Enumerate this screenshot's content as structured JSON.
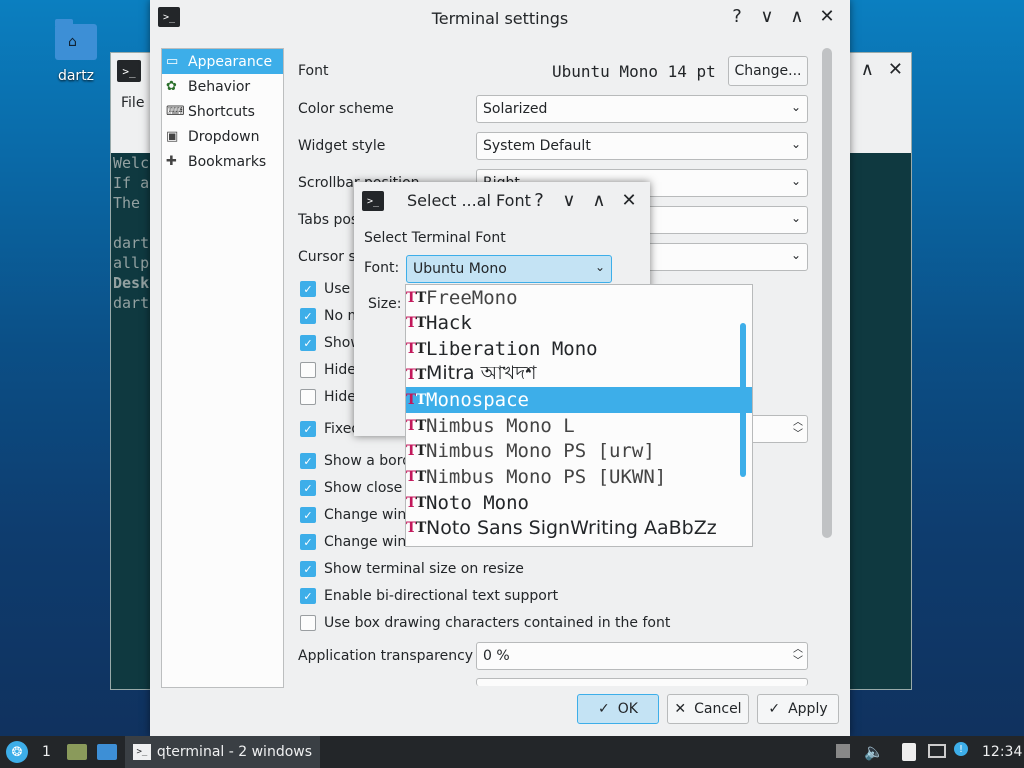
{
  "desktop": {
    "icon_label": "dartz"
  },
  "bg_window": {
    "menu_file": "File",
    "terminal_lines": [
      "Welc",
      "If a",
      "The ",
      "",
      "dart",
      "allp",
      "Desk",
      "dart"
    ]
  },
  "settings": {
    "title": "Terminal settings",
    "sidebar": [
      {
        "label": "Appearance",
        "icon": "monitor-icon"
      },
      {
        "label": "Behavior",
        "icon": "gear-icon"
      },
      {
        "label": "Shortcuts",
        "icon": "keyboard-icon"
      },
      {
        "label": "Dropdown",
        "icon": "dropdown-icon"
      },
      {
        "label": "Bookmarks",
        "icon": "bookmark-icon"
      }
    ],
    "font_label": "Font",
    "font_value": "Ubuntu Mono 14 pt",
    "change_button": "Change...",
    "color_scheme_label": "Color scheme",
    "color_scheme_value": "Solarized",
    "widget_style_label": "Widget style",
    "widget_style_value": "System Default",
    "scrollbar_label": "Scrollbar position",
    "scrollbar_value": "Right",
    "tabs_label": "Tabs pos",
    "cursor_label": "Cursor s",
    "partial_checks": [
      "Use l",
      "No m",
      "Show",
      "Hide",
      "Hide"
    ],
    "fixed_label": "Fixed",
    "checks": [
      {
        "label": "Show a bord",
        "on": true
      },
      {
        "label": "Show close b",
        "on": true
      },
      {
        "label": "Change wind",
        "on": true
      },
      {
        "label": "Change window icon based on current terminal",
        "on": true
      },
      {
        "label": "Show terminal size on resize",
        "on": true
      },
      {
        "label": "Enable bi-directional text support",
        "on": true
      },
      {
        "label": "Use box drawing characters contained in the font",
        "on": false
      }
    ],
    "transparency_label": "Application transparency",
    "transparency_value": "0 %",
    "ok": "OK",
    "cancel": "Cancel",
    "apply": "Apply"
  },
  "font_dialog": {
    "title": "Select ...al Font",
    "heading": "Select Terminal Font",
    "font_label": "Font:",
    "font_value": "Ubuntu Mono",
    "size_label": "Size:",
    "options": [
      "FreeMono",
      "Hack",
      "Liberation Mono",
      "Mitra আখদশ",
      "Monospace",
      "Nimbus Mono L",
      "Nimbus Mono PS [urw]",
      "Nimbus Mono PS [UKWN]",
      "Noto Mono",
      "Noto Sans SignWriting AaBbZz"
    ],
    "selected_index": 4
  },
  "taskbar": {
    "desktop_number": "1",
    "task_label": "qterminal - 2 windows",
    "clock": "12:34"
  },
  "colors": {
    "accent": "#3daee9",
    "panel": "#232629",
    "window": "#eff0f1"
  }
}
